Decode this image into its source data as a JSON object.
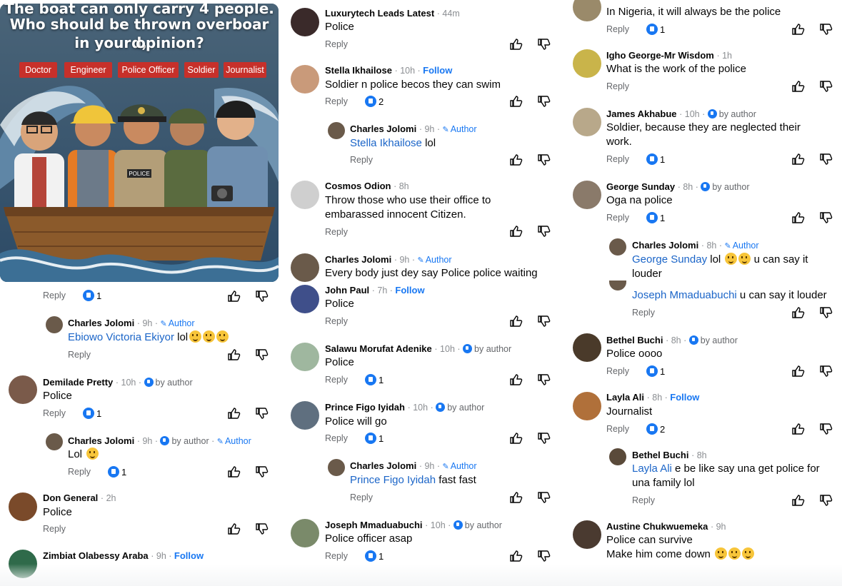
{
  "post_image": {
    "caption_top": "The boat can only carry 4 people.",
    "caption_line1": "Who should be thrown overboar d,",
    "caption_line2": "in your opinion?",
    "tags": [
      "Doctor",
      "Engineer",
      "Police Officer",
      "Soldier",
      "Journalist"
    ],
    "police_badge": "POLICE",
    "colors": {
      "tag_bg": "#c7302a",
      "sea": "#3a5a78",
      "boat": "#8b5a2b"
    }
  },
  "labels": {
    "reply": "Reply",
    "follow": "Follow",
    "author": "Author",
    "by_author": "by author"
  },
  "col1": {
    "top_actions": {
      "likes": "1"
    },
    "c1": {
      "name": "Charles Jolomi",
      "time": "9h",
      "mention": "Ebiowo Victoria Ekiyor",
      "text": " lol"
    },
    "c2": {
      "name": "Demilade Pretty",
      "time": "10h",
      "text": "Police",
      "likes": "1"
    },
    "c3": {
      "name": "Charles Jolomi",
      "time": "9h",
      "text": "Lol",
      "likes": "1"
    },
    "c4": {
      "name": "Don General",
      "time": "2h",
      "text": "Police"
    },
    "c5": {
      "name": "Zimbiat Olabessy Araba",
      "time": "9h"
    }
  },
  "col2": {
    "c1": {
      "name": "Luxurytech Leads Latest",
      "time": "44m",
      "text": "Police"
    },
    "c2": {
      "name": "Stella Ikhailose",
      "time": "10h",
      "text": "Soldier n police becos they can swim",
      "likes": "2"
    },
    "c3": {
      "name": "Charles Jolomi",
      "time": "9h",
      "mention": "Stella Ikhailose",
      "text": " lol"
    },
    "c4": {
      "name": "Cosmos Odion",
      "time": "8h",
      "text1": "Throw those who use their office to",
      "text2": "embarassed innocent Citizen."
    },
    "c5": {
      "name": "Charles Jolomi",
      "time": "9h",
      "text": "Every body just dey say Police police waiting"
    },
    "c6": {
      "name": "John Paul",
      "time": "7h",
      "text": "Police"
    },
    "c7": {
      "name": "Salawu Morufat Adenike",
      "time": "10h",
      "text": "Police",
      "likes": "1"
    },
    "c8": {
      "name": "Prince Figo Iyidah",
      "time": "10h",
      "text": "Police will go",
      "likes": "1"
    },
    "c9": {
      "name": "Charles Jolomi",
      "time": "9h",
      "mention": "Prince Figo Iyidah",
      "text": " fast fast"
    },
    "c10": {
      "name": "Joseph Mmaduabuchi",
      "time": "10h",
      "text": "Police officer asap",
      "likes": "1"
    }
  },
  "col3": {
    "c1": {
      "text": "In Nigeria, it will always be the police",
      "likes": "1"
    },
    "c2": {
      "name": "Igho George-Mr Wisdom",
      "time": "1h",
      "text": "What is the work of the police"
    },
    "c3": {
      "name": "James Akhabue",
      "time": "10h",
      "text1": "Soldier, because they are neglected their",
      "text2": "work.",
      "likes": "1"
    },
    "c4": {
      "name": "George Sunday",
      "time": "8h",
      "text": "Oga na police",
      "likes": "1"
    },
    "c5": {
      "name": "Charles Jolomi",
      "time": "8h",
      "mention": "George Sunday",
      "text1": " lol",
      "text1b": " u can say it",
      "text2": "louder"
    },
    "c6": {
      "mention": "Joseph Mmaduabuchi",
      "text": " u can say it louder"
    },
    "c7": {
      "name": "Bethel Buchi",
      "time": "8h",
      "text": "Police oooo",
      "likes": "1"
    },
    "c8": {
      "name": "Layla Ali",
      "time": "8h",
      "text": "Journalist",
      "likes": "2"
    },
    "c9": {
      "name": "Bethel Buchi",
      "time": "8h",
      "mention": "Layla Ali",
      "text1": " e be like say una get police for",
      "text2": "una family lol"
    },
    "c10": {
      "name": "Austine Chukwuemeka",
      "time": "9h",
      "text1": "Police can survive",
      "text2": "Make him come down"
    }
  }
}
